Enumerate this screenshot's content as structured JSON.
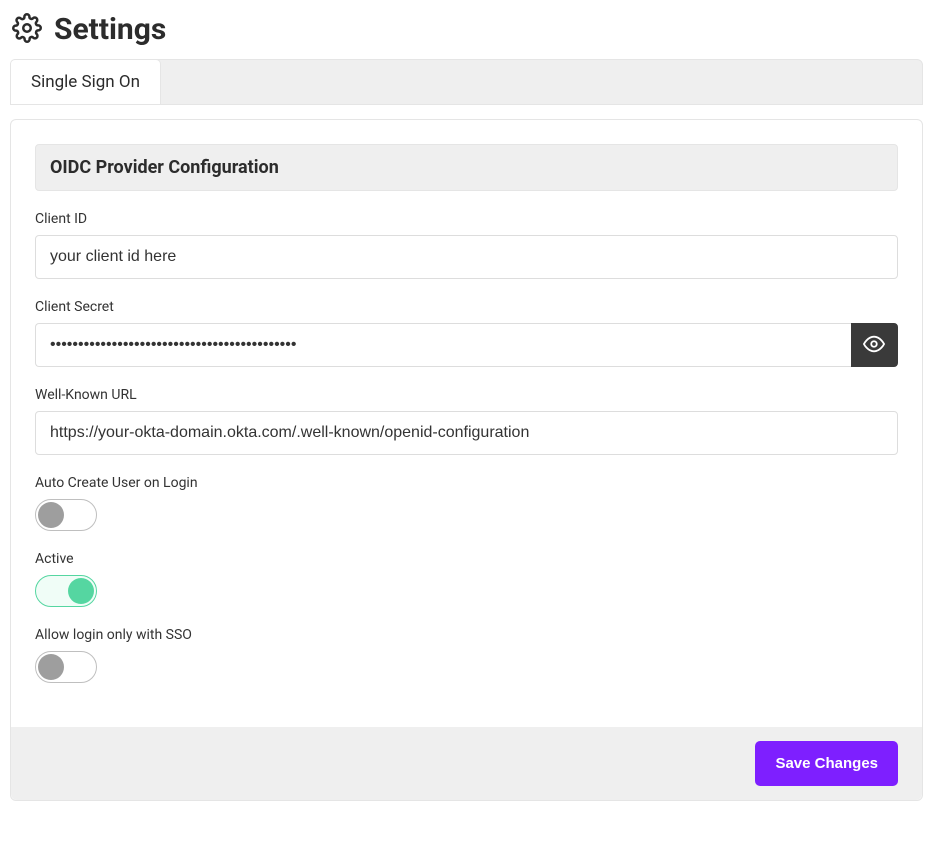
{
  "page": {
    "title": "Settings"
  },
  "tabs": {
    "sso": "Single Sign On"
  },
  "section": {
    "title": "OIDC Provider Configuration"
  },
  "fields": {
    "client_id": {
      "label": "Client ID",
      "value": "your client id here"
    },
    "client_secret": {
      "label": "Client Secret",
      "value": "••••••••••••••••••••••••••••••••••••••••••••"
    },
    "well_known_url": {
      "label": "Well-Known URL",
      "value": "https://your-okta-domain.okta.com/.well-known/openid-configuration"
    },
    "auto_create_user": {
      "label": "Auto Create User on Login",
      "on": false
    },
    "active": {
      "label": "Active",
      "on": true
    },
    "sso_only": {
      "label": "Allow login only with SSO",
      "on": false
    }
  },
  "actions": {
    "save": "Save Changes"
  }
}
